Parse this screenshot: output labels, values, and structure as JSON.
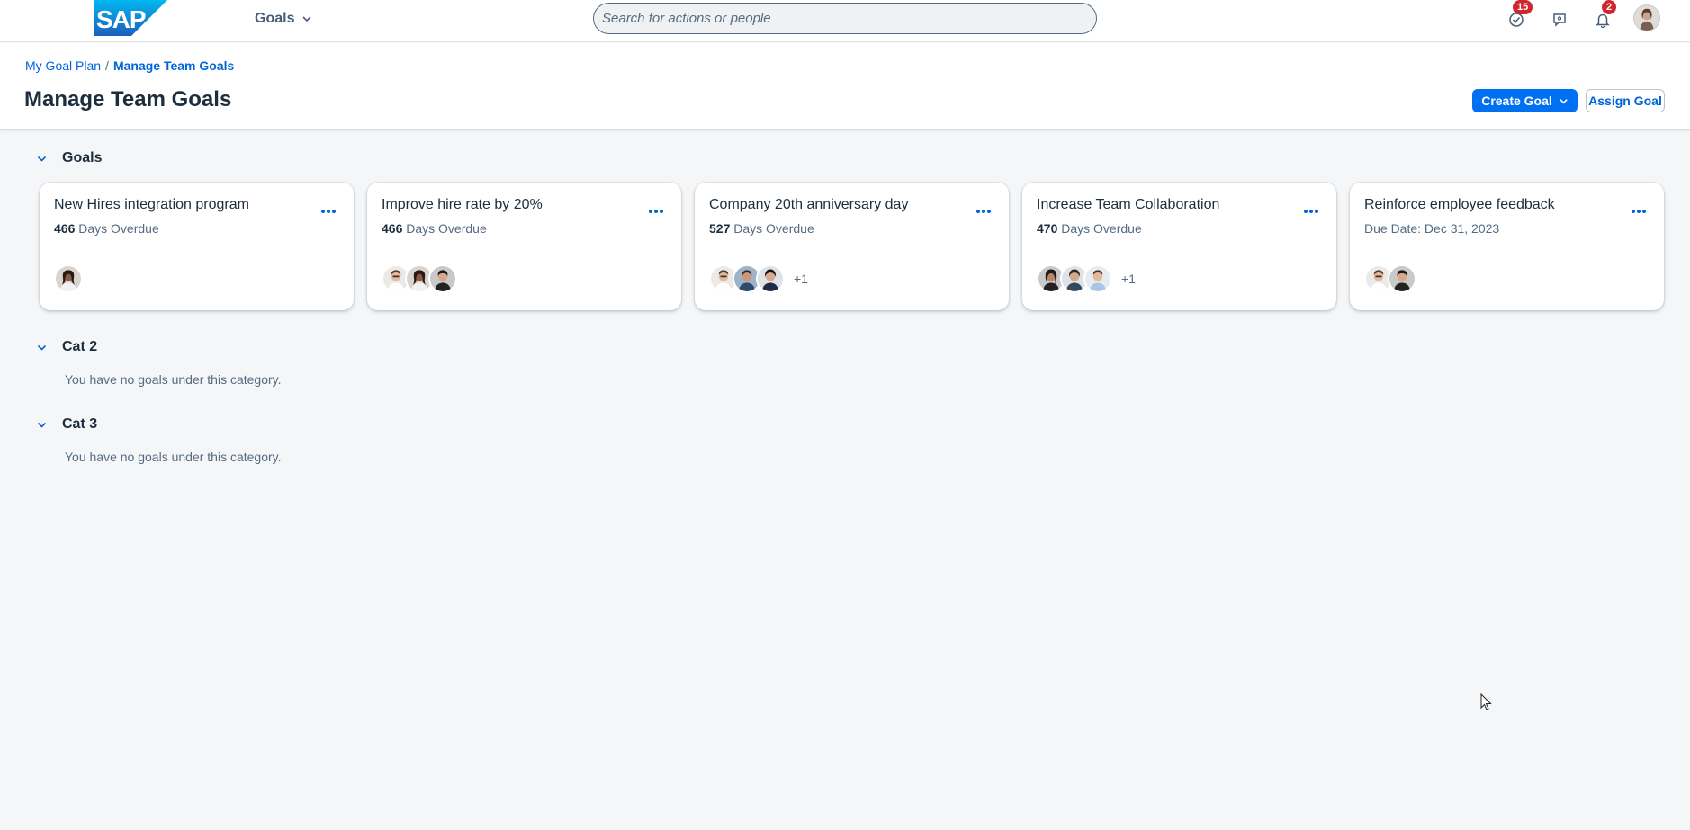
{
  "shell": {
    "logo_text": "SAP",
    "app_menu_label": "Goals",
    "search_placeholder": "Search for actions or people",
    "todo_badge": "15",
    "notifications_badge": "2"
  },
  "header": {
    "breadcrumb": {
      "parent": "My Goal Plan",
      "separator": "/",
      "current": "Manage Team Goals"
    },
    "title": "Manage Team Goals",
    "create_goal_label": "Create Goal",
    "assign_goal_label": "Assign Goal"
  },
  "sections": {
    "goals": {
      "title": "Goals",
      "cards": [
        {
          "title": "New Hires integration program",
          "count": "466",
          "status": "Days Overdue",
          "extra": ""
        },
        {
          "title": "Improve hire rate by 20%",
          "count": "466",
          "status": "Days Overdue",
          "extra": ""
        },
        {
          "title": "Company 20th anniversary day",
          "count": "527",
          "status": "Days Overdue",
          "extra": "+1"
        },
        {
          "title": "Increase Team Collaboration",
          "count": "470",
          "status": "Days Overdue",
          "extra": "+1"
        },
        {
          "title": "Reinforce employee feedback",
          "count": "",
          "status": "Due Date: Dec 31, 2023",
          "extra": ""
        }
      ]
    },
    "cat2": {
      "title": "Cat 2",
      "empty": "You have no goals under this category."
    },
    "cat3": {
      "title": "Cat 3",
      "empty": "You have no goals under this category."
    }
  },
  "colors": {
    "brand_blue": "#0070f2",
    "link_blue": "#0064d9",
    "badge_red": "#d0262c",
    "background": "#f5f6f7"
  }
}
